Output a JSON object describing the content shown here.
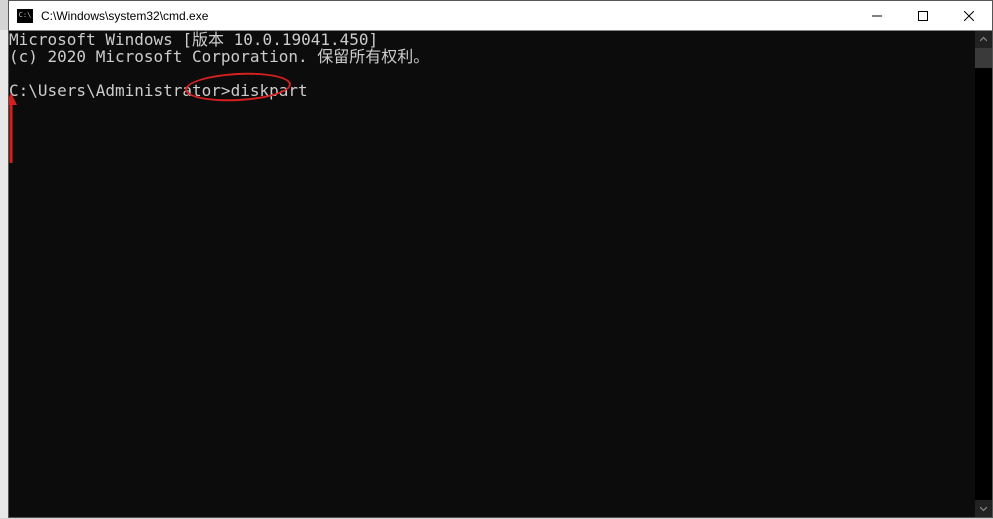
{
  "window": {
    "title": "C:\\Windows\\system32\\cmd.exe"
  },
  "terminal": {
    "line1": "Microsoft Windows [版本 10.0.19041.450]",
    "line2": "(c) 2020 Microsoft Corporation. 保留所有权利。",
    "prompt": "C:\\Users\\Administrator>",
    "command": "diskpart"
  },
  "annotation": {
    "circled_text": "diskpart"
  }
}
